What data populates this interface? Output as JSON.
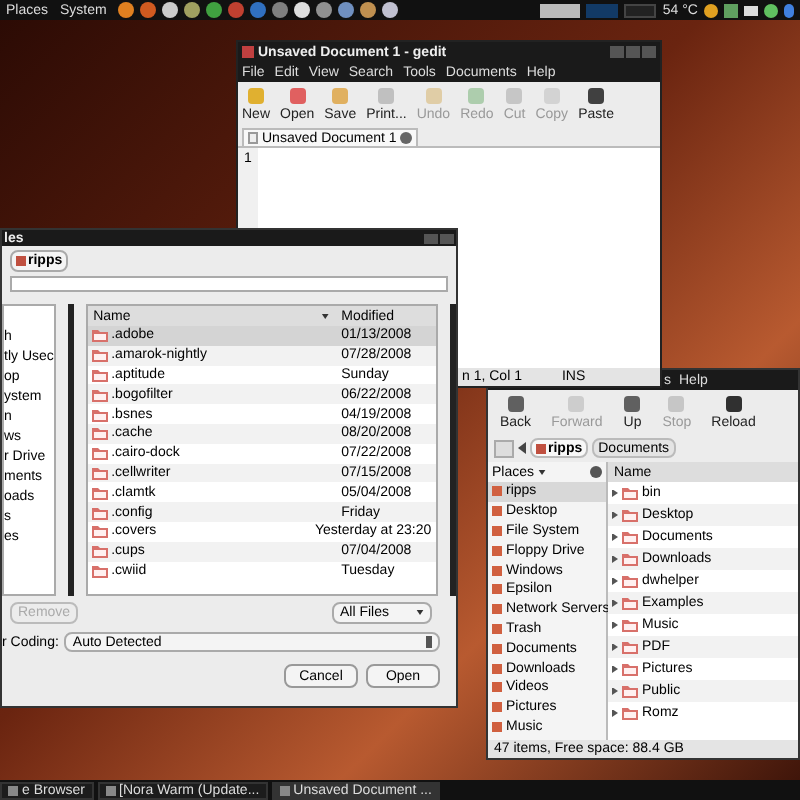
{
  "top_panel": {
    "menus": [
      "Places",
      "System"
    ],
    "temperature": "54 °C"
  },
  "gedit": {
    "title": "Unsaved Document 1 - gedit",
    "menus": [
      "File",
      "Edit",
      "View",
      "Search",
      "Tools",
      "Documents",
      "Help"
    ],
    "toolbar": [
      {
        "label": "New",
        "kind": "new",
        "disabled": false
      },
      {
        "label": "Open",
        "kind": "open",
        "disabled": false
      },
      {
        "label": "Save",
        "kind": "save",
        "disabled": false
      },
      {
        "label": "Print...",
        "kind": "print",
        "disabled": false
      },
      {
        "label": "Undo",
        "kind": "undo",
        "disabled": true
      },
      {
        "label": "Redo",
        "kind": "redo",
        "disabled": true
      },
      {
        "label": "Cut",
        "kind": "cut",
        "disabled": true
      },
      {
        "label": "Copy",
        "kind": "copy",
        "disabled": true
      },
      {
        "label": "Paste",
        "kind": "paste",
        "disabled": false
      }
    ],
    "tab": "Unsaved Document 1",
    "line_number": "1",
    "status_position": "n 1, Col 1",
    "status_mode": "INS"
  },
  "dialog": {
    "title": "les",
    "path_button": "ripps",
    "places": [
      {
        "label": "h",
        "selected": false
      },
      {
        "label": "tly Usec",
        "selected": false
      },
      {
        "label": "op",
        "selected": false
      },
      {
        "label": "ystem",
        "selected": false
      },
      {
        "label": "n",
        "selected": false
      },
      {
        "label": "ws",
        "selected": false
      },
      {
        "label": "r Drive",
        "selected": false
      },
      {
        "label": "ments",
        "selected": false
      },
      {
        "label": "oads",
        "selected": false
      },
      {
        "label": "s",
        "selected": false
      },
      {
        "label": "es",
        "selected": false
      }
    ],
    "columns": [
      "Name",
      "Modified"
    ],
    "rows": [
      {
        "name": ".adobe",
        "modified": "01/13/2008",
        "selected": true
      },
      {
        "name": ".amarok-nightly",
        "modified": "07/28/2008",
        "selected": false
      },
      {
        "name": ".aptitude",
        "modified": "Sunday",
        "selected": false
      },
      {
        "name": ".bogofilter",
        "modified": "06/22/2008",
        "selected": false
      },
      {
        "name": ".bsnes",
        "modified": "04/19/2008",
        "selected": false
      },
      {
        "name": ".cache",
        "modified": "08/20/2008",
        "selected": false
      },
      {
        "name": ".cairo-dock",
        "modified": "07/22/2008",
        "selected": false
      },
      {
        "name": ".cellwriter",
        "modified": "07/15/2008",
        "selected": false
      },
      {
        "name": ".clamtk",
        "modified": "05/04/2008",
        "selected": false
      },
      {
        "name": ".config",
        "modified": "Friday",
        "selected": false
      },
      {
        "name": ".covers",
        "modified": "Yesterday at 23:20",
        "selected": false
      },
      {
        "name": ".cups",
        "modified": "07/04/2008",
        "selected": false
      },
      {
        "name": ".cwiid",
        "modified": "Tuesday",
        "selected": false
      }
    ],
    "remove_button": {
      "label": "Remove",
      "disabled": true
    },
    "filter": "All Files",
    "coding_label": "r Coding:",
    "coding_value": "Auto Detected",
    "buttons": [
      "Cancel",
      "Open"
    ]
  },
  "nautilus": {
    "menus": [
      "s",
      "Help"
    ],
    "toolbar": [
      {
        "label": "Back",
        "kind": "back",
        "disabled": false
      },
      {
        "label": "Forward",
        "kind": "forward",
        "disabled": true
      },
      {
        "label": "Up",
        "kind": "up",
        "disabled": false
      },
      {
        "label": "Stop",
        "kind": "stop",
        "disabled": true
      },
      {
        "label": "Reload",
        "kind": "reload",
        "disabled": false
      }
    ],
    "path": [
      {
        "label": "ripps",
        "selected": true
      },
      {
        "label": "Documents",
        "selected": false
      }
    ],
    "places_header": "Places",
    "places": [
      {
        "label": "ripps",
        "selected": true
      },
      {
        "label": "Desktop",
        "selected": false
      },
      {
        "label": "File System",
        "selected": false
      },
      {
        "label": "Floppy Drive",
        "selected": false
      },
      {
        "label": "Windows",
        "selected": false
      },
      {
        "label": "Epsilon",
        "selected": false
      },
      {
        "label": "Network Servers",
        "selected": false
      },
      {
        "label": "Trash",
        "selected": false
      },
      {
        "label": "Documents",
        "selected": false
      },
      {
        "label": "Downloads",
        "selected": false
      },
      {
        "label": "Videos",
        "selected": false
      },
      {
        "label": "Pictures",
        "selected": false
      },
      {
        "label": "Music",
        "selected": false
      }
    ],
    "column": "Name",
    "files": [
      "bin",
      "Desktop",
      "Documents",
      "Downloads",
      "dwhelper",
      "Examples",
      "Music",
      "PDF",
      "Pictures",
      "Public",
      "Romz"
    ],
    "status": "47 items, Free space: 88.4 GB"
  },
  "taskbar": [
    {
      "label": "e Browser",
      "selected": false
    },
    {
      "label": "[Nora Warm (Update...",
      "selected": false
    },
    {
      "label": "Unsaved Document ...",
      "selected": true
    }
  ]
}
